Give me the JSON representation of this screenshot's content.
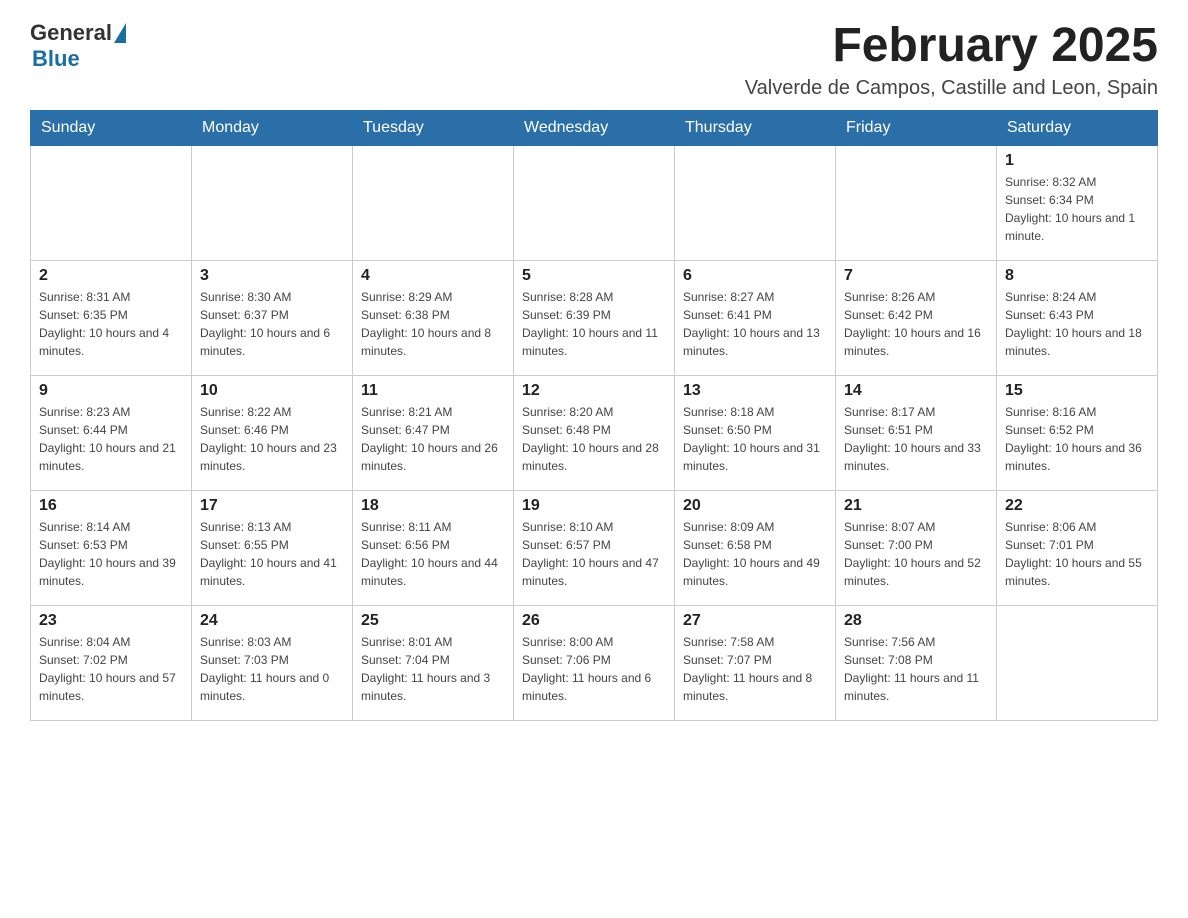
{
  "header": {
    "logo_general": "General",
    "logo_blue": "Blue",
    "month_title": "February 2025",
    "location": "Valverde de Campos, Castille and Leon, Spain"
  },
  "calendar": {
    "headers": [
      "Sunday",
      "Monday",
      "Tuesday",
      "Wednesday",
      "Thursday",
      "Friday",
      "Saturday"
    ],
    "weeks": [
      [
        {
          "day": "",
          "info": ""
        },
        {
          "day": "",
          "info": ""
        },
        {
          "day": "",
          "info": ""
        },
        {
          "day": "",
          "info": ""
        },
        {
          "day": "",
          "info": ""
        },
        {
          "day": "",
          "info": ""
        },
        {
          "day": "1",
          "info": "Sunrise: 8:32 AM\nSunset: 6:34 PM\nDaylight: 10 hours and 1 minute."
        }
      ],
      [
        {
          "day": "2",
          "info": "Sunrise: 8:31 AM\nSunset: 6:35 PM\nDaylight: 10 hours and 4 minutes."
        },
        {
          "day": "3",
          "info": "Sunrise: 8:30 AM\nSunset: 6:37 PM\nDaylight: 10 hours and 6 minutes."
        },
        {
          "day": "4",
          "info": "Sunrise: 8:29 AM\nSunset: 6:38 PM\nDaylight: 10 hours and 8 minutes."
        },
        {
          "day": "5",
          "info": "Sunrise: 8:28 AM\nSunset: 6:39 PM\nDaylight: 10 hours and 11 minutes."
        },
        {
          "day": "6",
          "info": "Sunrise: 8:27 AM\nSunset: 6:41 PM\nDaylight: 10 hours and 13 minutes."
        },
        {
          "day": "7",
          "info": "Sunrise: 8:26 AM\nSunset: 6:42 PM\nDaylight: 10 hours and 16 minutes."
        },
        {
          "day": "8",
          "info": "Sunrise: 8:24 AM\nSunset: 6:43 PM\nDaylight: 10 hours and 18 minutes."
        }
      ],
      [
        {
          "day": "9",
          "info": "Sunrise: 8:23 AM\nSunset: 6:44 PM\nDaylight: 10 hours and 21 minutes."
        },
        {
          "day": "10",
          "info": "Sunrise: 8:22 AM\nSunset: 6:46 PM\nDaylight: 10 hours and 23 minutes."
        },
        {
          "day": "11",
          "info": "Sunrise: 8:21 AM\nSunset: 6:47 PM\nDaylight: 10 hours and 26 minutes."
        },
        {
          "day": "12",
          "info": "Sunrise: 8:20 AM\nSunset: 6:48 PM\nDaylight: 10 hours and 28 minutes."
        },
        {
          "day": "13",
          "info": "Sunrise: 8:18 AM\nSunset: 6:50 PM\nDaylight: 10 hours and 31 minutes."
        },
        {
          "day": "14",
          "info": "Sunrise: 8:17 AM\nSunset: 6:51 PM\nDaylight: 10 hours and 33 minutes."
        },
        {
          "day": "15",
          "info": "Sunrise: 8:16 AM\nSunset: 6:52 PM\nDaylight: 10 hours and 36 minutes."
        }
      ],
      [
        {
          "day": "16",
          "info": "Sunrise: 8:14 AM\nSunset: 6:53 PM\nDaylight: 10 hours and 39 minutes."
        },
        {
          "day": "17",
          "info": "Sunrise: 8:13 AM\nSunset: 6:55 PM\nDaylight: 10 hours and 41 minutes."
        },
        {
          "day": "18",
          "info": "Sunrise: 8:11 AM\nSunset: 6:56 PM\nDaylight: 10 hours and 44 minutes."
        },
        {
          "day": "19",
          "info": "Sunrise: 8:10 AM\nSunset: 6:57 PM\nDaylight: 10 hours and 47 minutes."
        },
        {
          "day": "20",
          "info": "Sunrise: 8:09 AM\nSunset: 6:58 PM\nDaylight: 10 hours and 49 minutes."
        },
        {
          "day": "21",
          "info": "Sunrise: 8:07 AM\nSunset: 7:00 PM\nDaylight: 10 hours and 52 minutes."
        },
        {
          "day": "22",
          "info": "Sunrise: 8:06 AM\nSunset: 7:01 PM\nDaylight: 10 hours and 55 minutes."
        }
      ],
      [
        {
          "day": "23",
          "info": "Sunrise: 8:04 AM\nSunset: 7:02 PM\nDaylight: 10 hours and 57 minutes."
        },
        {
          "day": "24",
          "info": "Sunrise: 8:03 AM\nSunset: 7:03 PM\nDaylight: 11 hours and 0 minutes."
        },
        {
          "day": "25",
          "info": "Sunrise: 8:01 AM\nSunset: 7:04 PM\nDaylight: 11 hours and 3 minutes."
        },
        {
          "day": "26",
          "info": "Sunrise: 8:00 AM\nSunset: 7:06 PM\nDaylight: 11 hours and 6 minutes."
        },
        {
          "day": "27",
          "info": "Sunrise: 7:58 AM\nSunset: 7:07 PM\nDaylight: 11 hours and 8 minutes."
        },
        {
          "day": "28",
          "info": "Sunrise: 7:56 AM\nSunset: 7:08 PM\nDaylight: 11 hours and 11 minutes."
        },
        {
          "day": "",
          "info": ""
        }
      ]
    ]
  }
}
